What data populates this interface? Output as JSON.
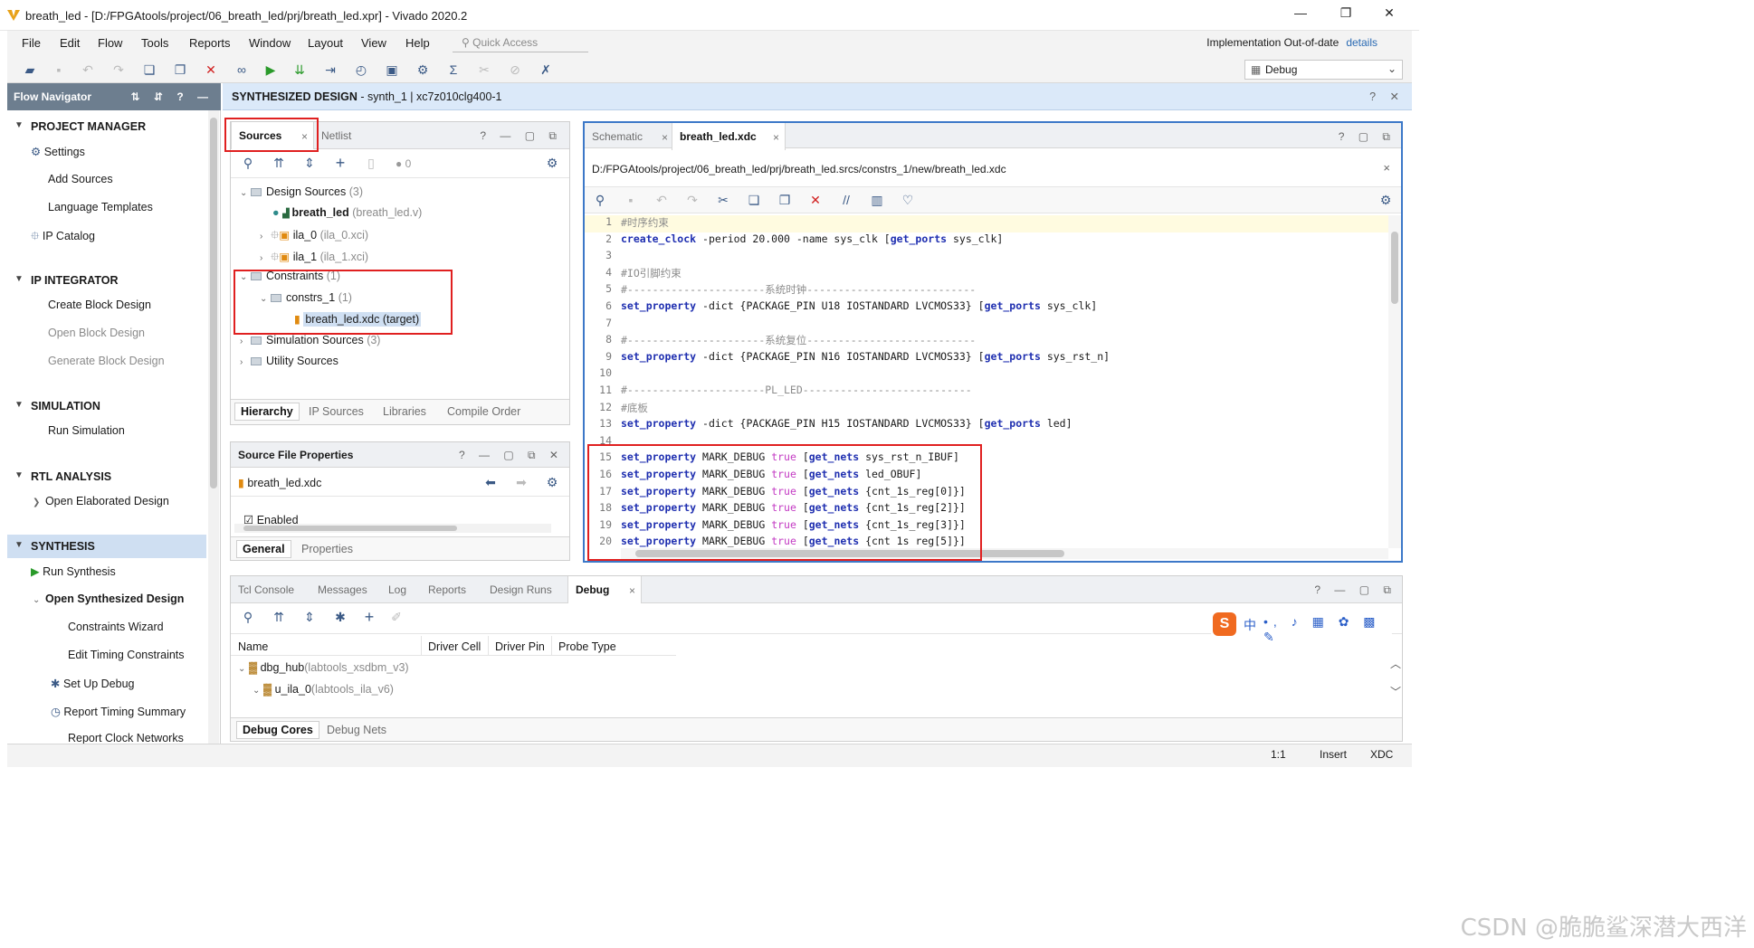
{
  "window": {
    "title": "breath_led - [D:/FPGAtools/project/06_breath_led/prj/breath_led.xpr] - Vivado 2020.2",
    "controls": [
      "—",
      "❐",
      "✕"
    ]
  },
  "menu": [
    "File",
    "Edit",
    "Flow",
    "Tools",
    "Reports",
    "Window",
    "Layout",
    "View",
    "Help"
  ],
  "quick_access": {
    "placeholder": "Quick Access"
  },
  "status": {
    "text": "Implementation Out-of-date",
    "link": "details"
  },
  "layout_select": "Debug",
  "flow_navigator": {
    "title": "Flow Navigator",
    "sections": [
      {
        "label": "PROJECT MANAGER",
        "items": [
          "Settings",
          "Add Sources",
          "Language Templates",
          "IP Catalog"
        ]
      },
      {
        "label": "IP INTEGRATOR",
        "items": [
          "Create Block Design",
          "Open Block Design",
          "Generate Block Design"
        ]
      },
      {
        "label": "SIMULATION",
        "items": [
          "Run Simulation"
        ]
      },
      {
        "label": "RTL ANALYSIS",
        "items": [
          "Open Elaborated Design"
        ]
      },
      {
        "label": "SYNTHESIS",
        "items": [
          "Run Synthesis",
          "Open Synthesized Design",
          "Constraints Wizard",
          "Edit Timing Constraints",
          "Set Up Debug",
          "Report Timing Summary",
          "Report Clock Networks"
        ]
      }
    ]
  },
  "banner": {
    "title": "SYNTHESIZED DESIGN",
    "detail": " - synth_1 | xc7z010clg400-1"
  },
  "sources": {
    "tabs": [
      "Sources",
      "Netlist"
    ],
    "badge": "0",
    "tree": {
      "design_sources": {
        "label": "Design Sources",
        "count": "(3)"
      },
      "top": {
        "label": "breath_led",
        "file": "(breath_led.v)"
      },
      "ila0": {
        "label": "ila_0",
        "file": "(ila_0.xci)"
      },
      "ila1": {
        "label": "ila_1",
        "file": "(ila_1.xci)"
      },
      "constraints": {
        "label": "Constraints",
        "count": "(1)"
      },
      "constrs": {
        "label": "constrs_1",
        "count": "(1)"
      },
      "xdc": {
        "label": "breath_led.xdc (target)"
      },
      "sim": {
        "label": "Simulation Sources",
        "count": "(3)"
      },
      "util": {
        "label": "Utility Sources"
      }
    },
    "bottom_tabs": [
      "Hierarchy",
      "IP Sources",
      "Libraries",
      "Compile Order"
    ]
  },
  "file_props": {
    "title": "Source File Properties",
    "file": "breath_led.xdc",
    "enabled": "Enabled",
    "tabs": [
      "General",
      "Properties"
    ]
  },
  "editor": {
    "tabs": [
      "Schematic",
      "breath_led.xdc"
    ],
    "path": "D:/FPGAtools/project/06_breath_led/prj/breath_led.srcs/constrs_1/new/breath_led.xdc",
    "lines": [
      {
        "n": "1",
        "parts": [
          [
            "cm",
            "#时序约束"
          ]
        ]
      },
      {
        "n": "2",
        "parts": [
          [
            "kw",
            "create_clock"
          ],
          [
            "",
            " -period 20.000 -name sys_clk ["
          ],
          [
            "kw",
            "get_ports"
          ],
          [
            "",
            " sys_clk]"
          ]
        ]
      },
      {
        "n": "3",
        "parts": []
      },
      {
        "n": "4",
        "parts": [
          [
            "cm",
            "#IO引脚约束"
          ]
        ]
      },
      {
        "n": "5",
        "parts": [
          [
            "cm",
            "#----------------------系统时钟---------------------------"
          ]
        ]
      },
      {
        "n": "6",
        "parts": [
          [
            "kw",
            "set_property"
          ],
          [
            "",
            " -dict {PACKAGE_PIN U18 IOSTANDARD LVCMOS33} ["
          ],
          [
            "kw",
            "get_ports"
          ],
          [
            "",
            " sys_clk]"
          ]
        ]
      },
      {
        "n": "7",
        "parts": []
      },
      {
        "n": "8",
        "parts": [
          [
            "cm",
            "#----------------------系统复位---------------------------"
          ]
        ]
      },
      {
        "n": "9",
        "parts": [
          [
            "kw",
            "set_property"
          ],
          [
            "",
            " -dict {PACKAGE_PIN N16 IOSTANDARD LVCMOS33} ["
          ],
          [
            "kw",
            "get_ports"
          ],
          [
            "",
            " sys_rst_n]"
          ]
        ]
      },
      {
        "n": "10",
        "parts": []
      },
      {
        "n": "11",
        "parts": [
          [
            "cm",
            "#----------------------PL_LED---------------------------"
          ]
        ]
      },
      {
        "n": "12",
        "parts": [
          [
            "cm",
            "#底板"
          ]
        ]
      },
      {
        "n": "13",
        "parts": [
          [
            "kw",
            "set_property"
          ],
          [
            "",
            " -dict {PACKAGE_PIN H15 IOSTANDARD LVCMOS33} ["
          ],
          [
            "kw",
            "get_ports"
          ],
          [
            "",
            " led]"
          ]
        ]
      },
      {
        "n": "14",
        "parts": []
      },
      {
        "n": "15",
        "parts": [
          [
            "kw",
            "set_property"
          ],
          [
            "",
            " MARK_DEBUG "
          ],
          [
            "tr",
            "true"
          ],
          [
            "",
            " ["
          ],
          [
            "kw",
            "get_nets"
          ],
          [
            "",
            " sys_rst_n_IBUF]"
          ]
        ]
      },
      {
        "n": "16",
        "parts": [
          [
            "kw",
            "set_property"
          ],
          [
            "",
            " MARK_DEBUG "
          ],
          [
            "tr",
            "true"
          ],
          [
            "",
            " ["
          ],
          [
            "kw",
            "get_nets"
          ],
          [
            "",
            " led_OBUF]"
          ]
        ]
      },
      {
        "n": "17",
        "parts": [
          [
            "kw",
            "set_property"
          ],
          [
            "",
            " MARK_DEBUG "
          ],
          [
            "tr",
            "true"
          ],
          [
            "",
            " ["
          ],
          [
            "kw",
            "get_nets"
          ],
          [
            "",
            " {cnt_1s_reg[0]}]"
          ]
        ]
      },
      {
        "n": "18",
        "parts": [
          [
            "kw",
            "set_property"
          ],
          [
            "",
            " MARK_DEBUG "
          ],
          [
            "tr",
            "true"
          ],
          [
            "",
            " ["
          ],
          [
            "kw",
            "get_nets"
          ],
          [
            "",
            " {cnt_1s_reg[2]}]"
          ]
        ]
      },
      {
        "n": "19",
        "parts": [
          [
            "kw",
            "set_property"
          ],
          [
            "",
            " MARK_DEBUG "
          ],
          [
            "tr",
            "true"
          ],
          [
            "",
            " ["
          ],
          [
            "kw",
            "get_nets"
          ],
          [
            "",
            " {cnt_1s_reg[3]}]"
          ]
        ]
      },
      {
        "n": "20",
        "parts": [
          [
            "kw",
            "set_property"
          ],
          [
            "",
            " MARK_DEBUG "
          ],
          [
            "tr",
            "true"
          ],
          [
            "",
            " ["
          ],
          [
            "kw",
            "get_nets"
          ],
          [
            "",
            " {cnt 1s reg[5]}]"
          ]
        ]
      }
    ]
  },
  "console": {
    "tabs": [
      "Tcl Console",
      "Messages",
      "Log",
      "Reports",
      "Design Runs",
      "Debug"
    ],
    "columns": [
      "Name",
      "Driver Cell",
      "Driver Pin",
      "Probe Type"
    ],
    "rows": [
      {
        "name": "dbg_hub",
        "type": "(labtools_xsdbm_v3)"
      },
      {
        "name": "u_ila_0",
        "type": "(labtools_ila_v6)"
      }
    ],
    "bottom_tabs": [
      "Debug Cores",
      "Debug Nets"
    ]
  },
  "ime_toolbar": "中",
  "statusbar": {
    "pos": "1:1",
    "mode": "Insert",
    "lang": "XDC"
  },
  "watermark": "CSDN @脆脆鲨深潜大西洋"
}
